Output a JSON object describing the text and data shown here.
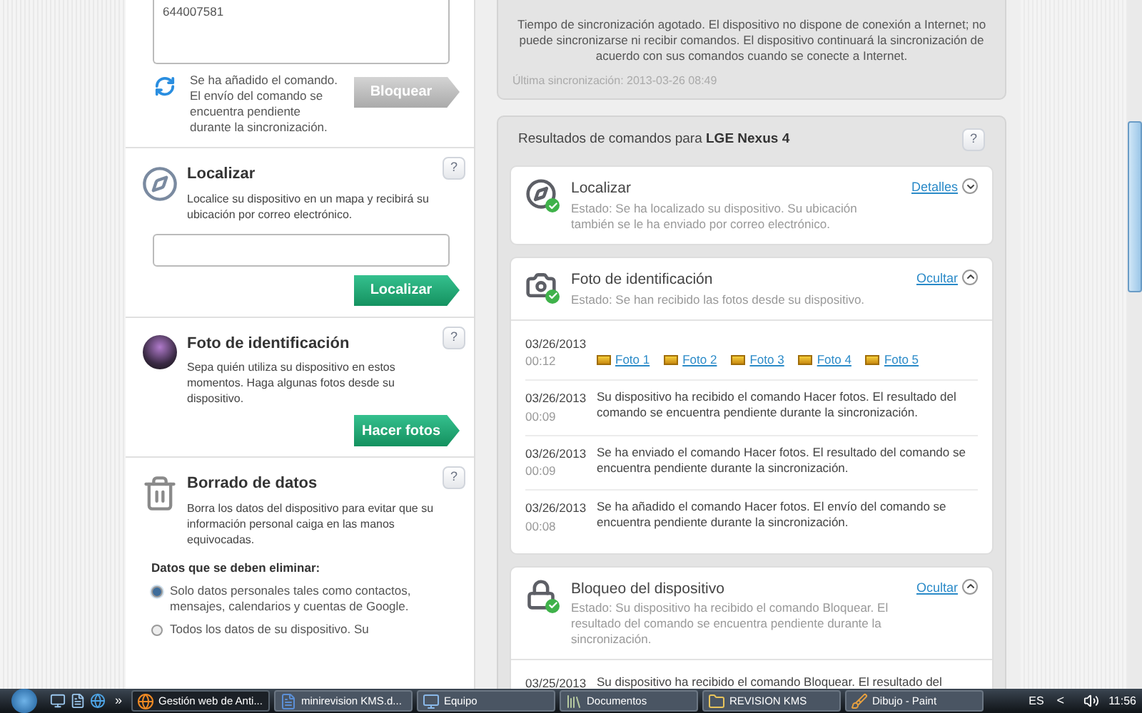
{
  "left_panel": {
    "message_box": {
      "value": "644007581"
    },
    "lock_status": {
      "text": "Se ha añadido el comando. El envío del comando se encuentra pendiente durante la sincronización.",
      "button": {
        "label": "Bloquear",
        "disabled": true
      }
    },
    "sections": [
      {
        "kind": "locate",
        "title": "Localizar",
        "help": "?",
        "description": "Localice su dispositivo en un mapa y recibirá su ubicación por correo electrónico.",
        "button": {
          "label": "Localizar",
          "disabled": false
        }
      },
      {
        "kind": "photo",
        "title": "Foto de identificación",
        "help": "?",
        "description": "Sepa quién utiliza su dispositivo en estos momentos. Haga algunas fotos desde su dispositivo.",
        "button": {
          "label": "Hacer fotos",
          "disabled": false
        }
      },
      {
        "kind": "wipe",
        "title": "Borrado de datos",
        "help": "?",
        "description": "Borra los datos del dispositivo para evitar que su información personal caiga en las manos equivocadas.",
        "subheading": "Datos que se deben eliminar:",
        "options": [
          {
            "label": "Solo datos personales tales como contactos, mensajes, calendarios y cuentas de Google.",
            "selected": true
          },
          {
            "label": "Todos los datos de su dispositivo. Su",
            "selected": false
          }
        ]
      }
    ]
  },
  "sync_panel": {
    "message": "Tiempo de sincronización agotado. El dispositivo no dispone de conexión a Internet; no puede sincronizarse ni recibir comandos. El dispositivo continuará la sincronización de acuerdo con sus comandos cuando se conecte a Internet.",
    "last_sync": "Última sincronización: 2013-03-26 08:49"
  },
  "results": {
    "title": "Resultados de comandos para",
    "device": "LGE Nexus 4",
    "help": "?",
    "cards": [
      {
        "kind": "locate",
        "title": "Localizar",
        "status": "Estado: Se ha localizado su dispositivo. Su ubicación también se le ha enviado por correo electrónico.",
        "toggle": "Detalles",
        "expanded": false
      },
      {
        "kind": "camera",
        "title": "Foto de identificación",
        "status": "Estado: Se han recibido las fotos desde su dispositivo.",
        "toggle": "Ocultar",
        "expanded": true,
        "entries": [
          {
            "date": "03/26/2013",
            "time": "00:12",
            "photos": [
              "Foto 1",
              "Foto 2",
              "Foto 3",
              "Foto 4",
              "Foto 5"
            ]
          },
          {
            "date": "03/26/2013",
            "time": "00:09",
            "text": "Su dispositivo ha recibido el comando Hacer fotos. El resultado del comando se encuentra pendiente durante la sincronización."
          },
          {
            "date": "03/26/2013",
            "time": "00:09",
            "text": "Se ha enviado el comando Hacer fotos. El resultado del comando se encuentra pendiente durante la sincronización."
          },
          {
            "date": "03/26/2013",
            "time": "00:08",
            "text": "Se ha añadido el comando Hacer fotos. El envío del comando se encuentra pendiente durante la sincronización."
          }
        ]
      },
      {
        "kind": "lock",
        "title": "Bloqueo del dispositivo",
        "status": "Estado: Su dispositivo ha recibido el comando Bloquear. El resultado del comando se encuentra pendiente durante la sincronización.",
        "toggle": "Ocultar",
        "expanded": true,
        "entries": [
          {
            "date": "03/25/2013",
            "text": "Su dispositivo ha recibido el comando Bloquear. El resultado del"
          }
        ]
      }
    ]
  },
  "taskbar": {
    "items": [
      {
        "kind": "browser",
        "label": "Gestión web de Anti...",
        "selected": true
      },
      {
        "kind": "document",
        "label": "minirevision KMS.d...",
        "selected": false
      },
      {
        "kind": "computer",
        "label": "Equipo",
        "selected": false
      },
      {
        "kind": "library",
        "label": "Documentos",
        "selected": false
      },
      {
        "kind": "folder",
        "label": "REVISION KMS",
        "selected": false
      },
      {
        "kind": "paint",
        "label": "Dibujo - Paint",
        "selected": false
      }
    ],
    "language": "ES",
    "chevron": "<",
    "more": "»",
    "clock": "11:56"
  }
}
